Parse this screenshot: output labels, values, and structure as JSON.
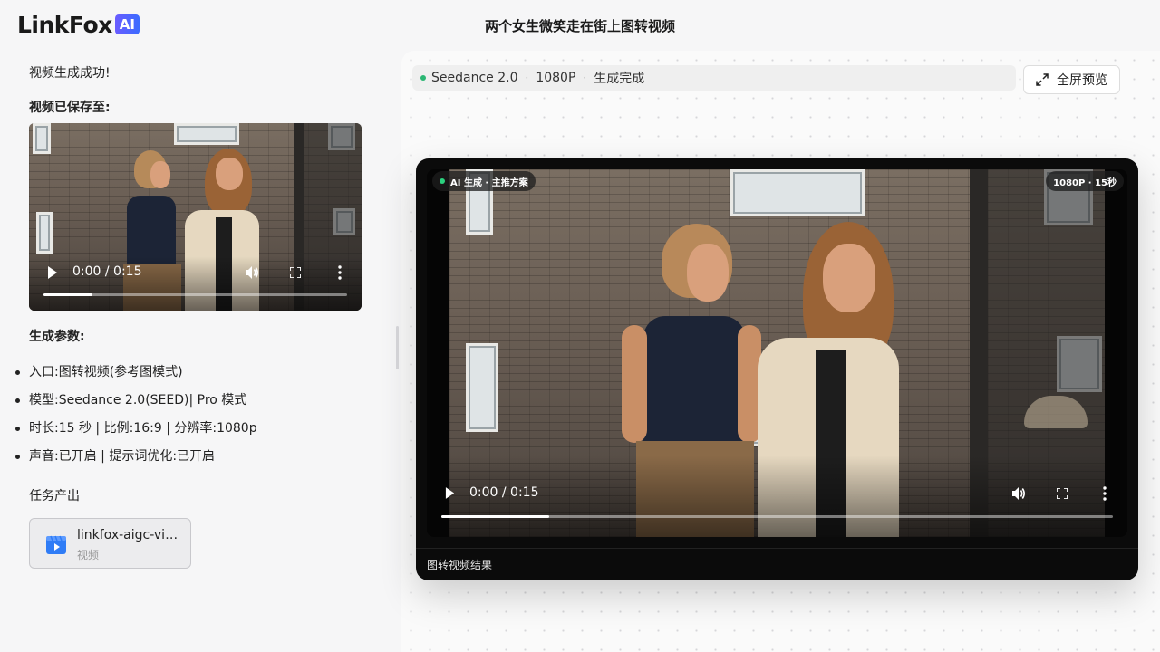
{
  "app": {
    "logo_text": "LinkFox",
    "logo_badge": "AI",
    "page_title": "两个女生微笑走在街上图转视频"
  },
  "left": {
    "success_text": "视频生成成功!",
    "saved_label": "视频已保存至:",
    "mini_player": {
      "time": "0:00 / 0:15",
      "progress": 0.16
    },
    "params_label": "生成参数:",
    "params": [
      "入口:图转视频(参考图模式)",
      "模型:Seedance 2.0(SEED)| Pro 模式",
      "时长:15 秒 | 比例:16:9 | 分辨率:1080p",
      "声音:已开启 | 提示词优化:已开启"
    ],
    "task_label": "任务产出",
    "file": {
      "name": "linkfox-aigc-video",
      "type": "视频",
      "icon": "video-file-icon"
    }
  },
  "right": {
    "info": {
      "model": "Seedance 2.0",
      "resolution": "1080P",
      "status": "生成完成"
    },
    "fullscreen_label": "全屏预览",
    "player": {
      "tag_left": "AI 生成 · 主推方案",
      "tag_right": "1080P · 15秒",
      "time": "0:00 / 0:15",
      "progress": 0.16
    },
    "caption": "图转视频结果"
  },
  "colors": {
    "accent": "#5b63ff",
    "status_green": "#2bb673",
    "video_bg": "#0b0b0b"
  }
}
